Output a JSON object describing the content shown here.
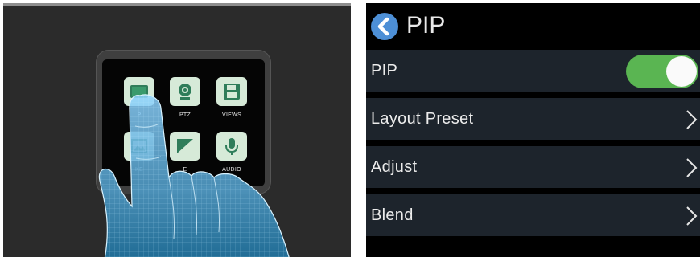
{
  "left_device": {
    "apps": [
      {
        "label": "P",
        "icon": "picture-icon"
      },
      {
        "label": "PTZ",
        "icon": "camera-icon"
      },
      {
        "label": "VIEWS",
        "icon": "save-icon"
      },
      {
        "label": "KE",
        "icon": "image-icon"
      },
      {
        "label": "E",
        "icon": "transition-icon"
      },
      {
        "label": "AUDIO",
        "icon": "microphone-icon"
      }
    ]
  },
  "menu": {
    "header_title": "PIP",
    "back_icon": "back-arrow-icon",
    "pip_row": {
      "label": "PIP",
      "toggle_on": true
    },
    "rows": [
      {
        "label": "Layout Preset",
        "icon": "chevron-right-icon"
      },
      {
        "label": "Adjust",
        "icon": "chevron-right-icon"
      },
      {
        "label": "Blend",
        "icon": "chevron-right-icon"
      }
    ]
  },
  "colors": {
    "menu_row_background": "#1d242c",
    "toggle_on": "#5ab552",
    "back_button": "#4d8fd6",
    "app_icon_background": "#d6ead8"
  }
}
